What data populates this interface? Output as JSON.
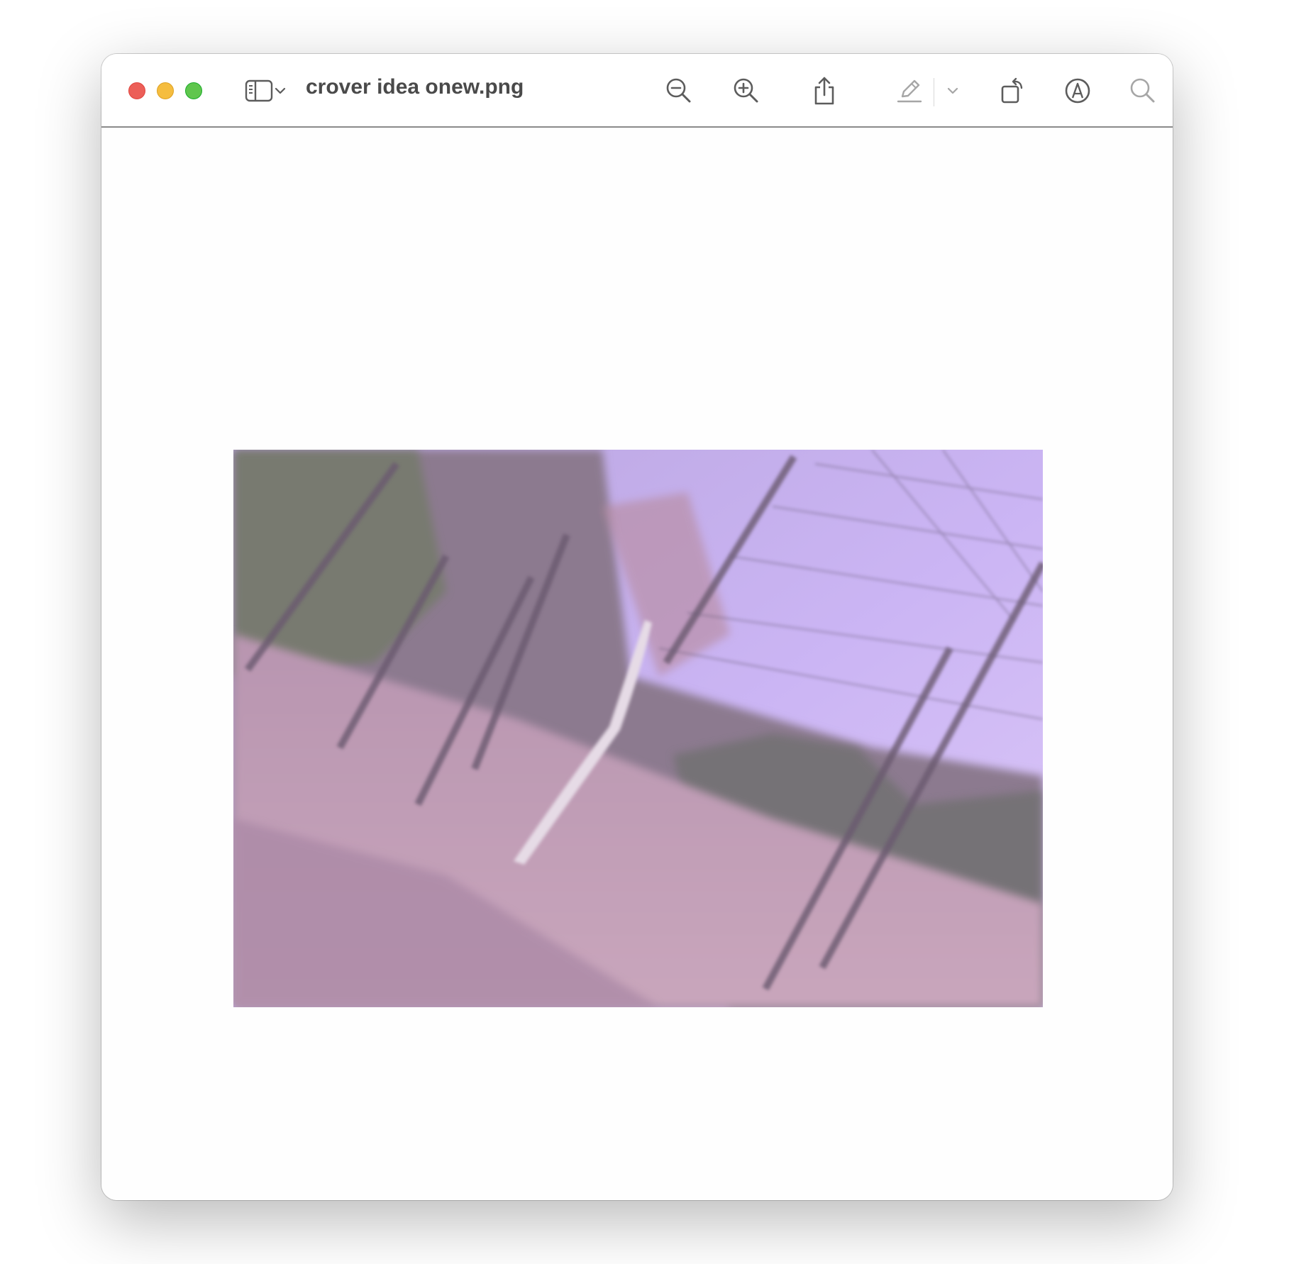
{
  "window": {
    "title": "crover idea onew.png",
    "traffic_lights": {
      "close": {
        "icon": "close-icon",
        "color": "#ec5f58"
      },
      "minimize": {
        "icon": "minimize-icon",
        "color": "#f5bd3f"
      },
      "zoom": {
        "icon": "zoom-icon",
        "color": "#5fc64d"
      }
    }
  },
  "toolbar": {
    "sidebar_toggle_icon": "sidebar-icon",
    "sidebar_menu_icon": "chevron-down-icon",
    "zoom_out_icon": "zoom-out-icon",
    "zoom_in_icon": "zoom-in-icon",
    "share_icon": "share-icon",
    "highlight_icon": "highlighter-icon",
    "highlight_menu_icon": "chevron-down-icon",
    "rotate_icon": "rotate-icon",
    "markup_icon": "markup-icon",
    "search_icon": "search-icon"
  },
  "document": {
    "image_description_colors": {
      "sky": "#cbb5f4",
      "foliage": "#7a6e7c",
      "ground": "#c9a6bc"
    }
  }
}
